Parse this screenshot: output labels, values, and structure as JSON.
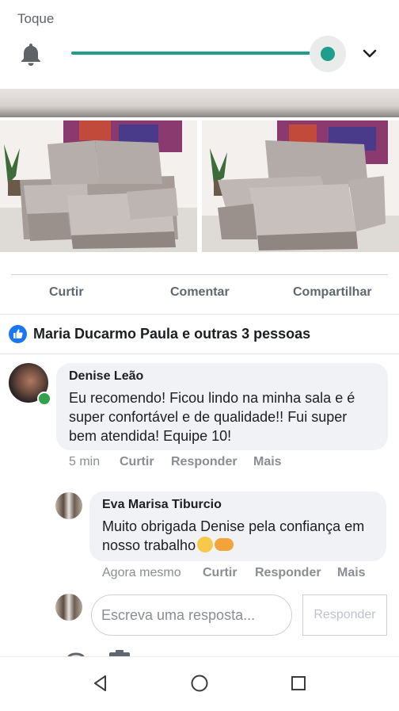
{
  "volume_panel": {
    "title": "Toque",
    "level_fraction": 1.0,
    "accent_color": "#1f9e8c",
    "icon": "bell-icon",
    "expand_icon": "chevron-down-icon"
  },
  "post": {
    "actions": {
      "like": "Curtir",
      "comment": "Comentar",
      "share": "Compartilhar"
    },
    "reactions": {
      "icon": "like-icon",
      "text": "Maria Ducarmo Paula e outras 3 pessoas"
    }
  },
  "comments": [
    {
      "author": "Denise Leão",
      "text": "Eu recomendo! Ficou lindo na minha sala e é super confortável e de qualidade!! Fui super bem atendida! Equipe 10!",
      "time": "5 min",
      "like": "Curtir",
      "reply": "Responder",
      "more": "Mais"
    }
  ],
  "replies": [
    {
      "author": "Eva Marisa Tiburcio",
      "text": "Muito obrigada Denise pela confiança em nosso trabalho",
      "time": "Agora mesmo",
      "like": "Curtir",
      "reply": "Responder",
      "more": "Mais"
    }
  ],
  "reply_box": {
    "placeholder": "Escreva uma resposta...",
    "button": "Responder"
  },
  "navbar": {
    "back": "back-icon",
    "home": "home-icon",
    "recents": "recents-icon"
  }
}
